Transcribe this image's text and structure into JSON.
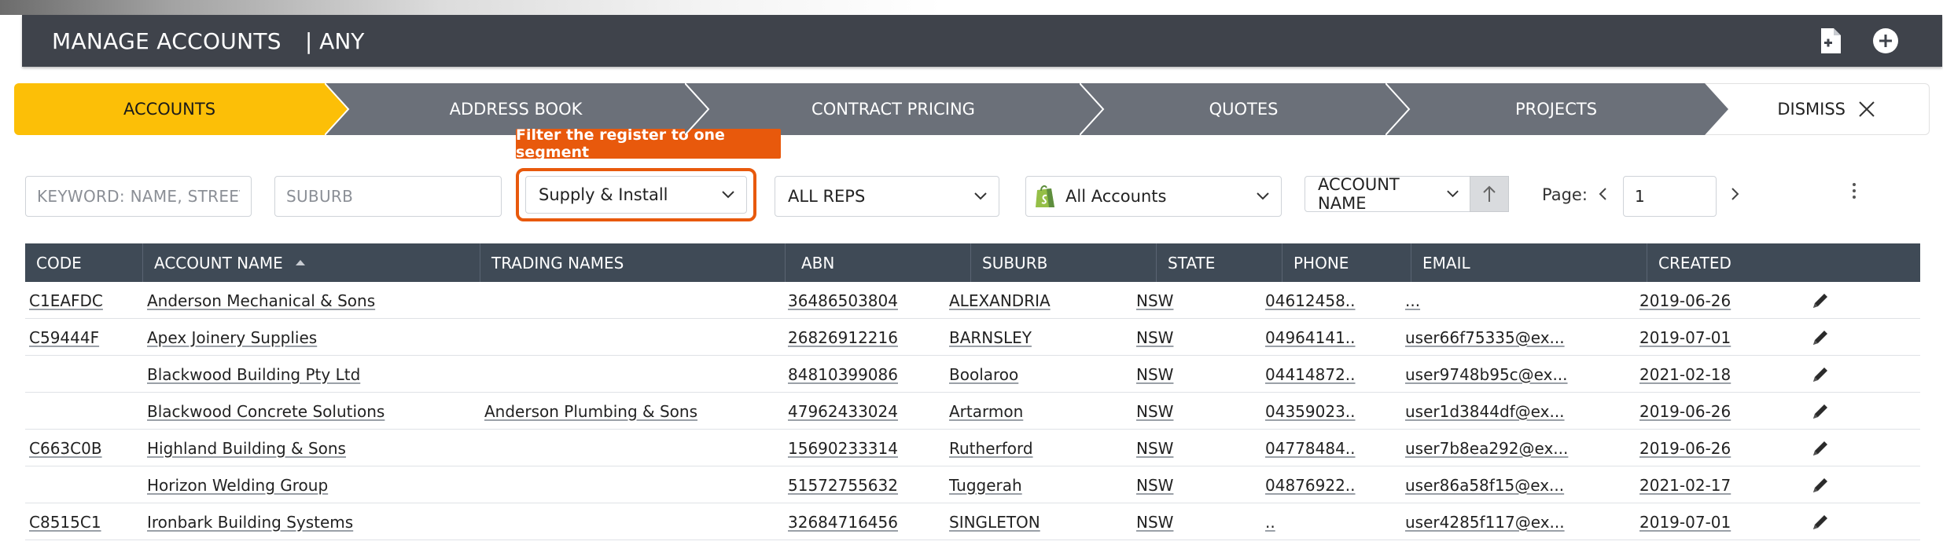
{
  "header": {
    "title": "MANAGE ACCOUNTS",
    "scope": "| ANY",
    "icons": [
      "new-document-icon",
      "plus-circle-icon"
    ]
  },
  "steps": [
    {
      "label": "ACCOUNTS",
      "active": true
    },
    {
      "label": "ADDRESS BOOK",
      "active": false
    },
    {
      "label": "CONTRACT PRICING",
      "active": false
    },
    {
      "label": "QUOTES",
      "active": false
    },
    {
      "label": "PROJECTS",
      "active": false
    }
  ],
  "dismiss": {
    "label": "DISMISS",
    "icon": "close-icon"
  },
  "tooltip": "Filter the register to one segment",
  "filters": {
    "keyword_placeholder": "KEYWORD: NAME, STREET,",
    "suburb_placeholder": "SUBURB",
    "segment": "Supply & Install",
    "reps": "ALL REPS",
    "accounts": "All Accounts",
    "sort_by": "ACCOUNT NAME",
    "page_label": "Page:",
    "page_value": "1"
  },
  "colors": {
    "header_bg": "#3f434b",
    "active_step": "#fcbf07",
    "step_bg": "#6b7079",
    "highlight": "#e8590c",
    "table_head": "#3f4a56",
    "shopify_green": "#95bf47"
  },
  "table": {
    "columns": [
      "CODE",
      "ACCOUNT NAME",
      "TRADING NAMES",
      "ABN",
      "SUBURB",
      "STATE",
      "PHONE",
      "EMAIL",
      "CREATED"
    ],
    "rows": [
      [
        "C1EAFDC",
        "Anderson Mechanical & Sons",
        "",
        "36486503804",
        "ALEXANDRIA",
        "NSW",
        "04612458..",
        "...",
        "2019-06-26"
      ],
      [
        "C59444F",
        "Apex Joinery Supplies",
        "",
        "26826912216",
        "BARNSLEY",
        "NSW",
        "04964141..",
        "user66f75335@ex...",
        "2019-07-01"
      ],
      [
        "",
        "Blackwood Building Pty Ltd",
        "",
        "84810399086",
        "Boolaroo",
        "NSW",
        "04414872..",
        "user9748b95c@ex...",
        "2021-02-18"
      ],
      [
        "",
        "Blackwood Concrete Solutions",
        "Anderson Plumbing & Sons",
        "47962433024",
        "Artarmon",
        "NSW",
        "04359023..",
        "user1d3844df@ex...",
        "2019-06-26"
      ],
      [
        "C663C0B",
        "Highland Building & Sons",
        "",
        "15690233314",
        "Rutherford",
        "NSW",
        "04778484..",
        "user7b8ea292@ex...",
        "2019-06-26"
      ],
      [
        "",
        "Horizon Welding Group",
        "",
        "51572755632",
        "Tuggerah",
        "NSW",
        "04876922..",
        "user86a58f15@ex...",
        "2021-02-17"
      ],
      [
        "C8515C1",
        "Ironbark Building Systems",
        "",
        "32684716456",
        "SINGLETON",
        "NSW",
        "..",
        "user4285f117@ex...",
        "2019-07-01"
      ]
    ]
  }
}
